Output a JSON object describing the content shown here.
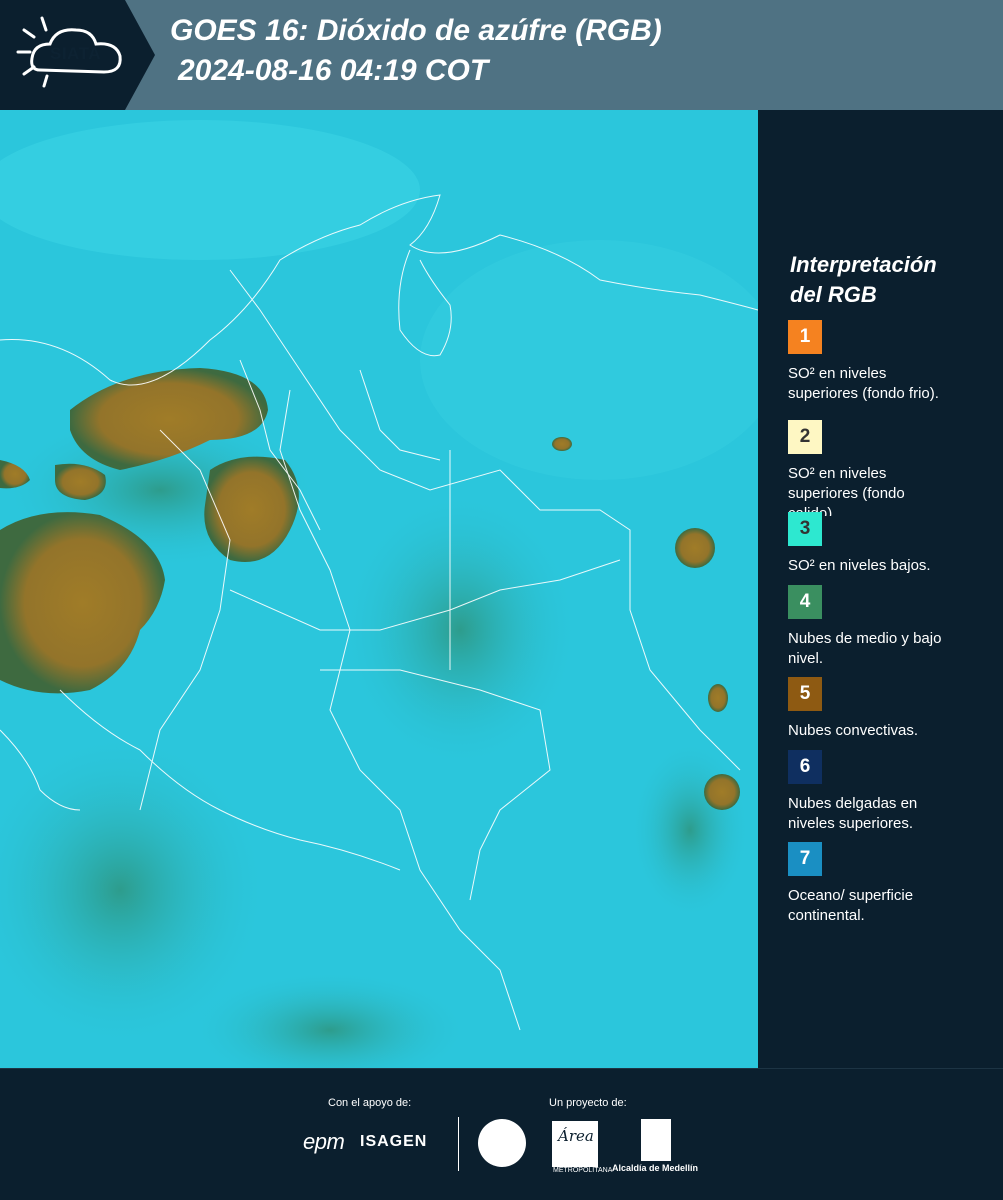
{
  "header": {
    "logo_text": "SIATA",
    "title_line1": "GOES 16: Dióxido de azúfre (RGB)",
    "title_line2": "2024-08-16 04:19 COT",
    "background_color": "#4f7283"
  },
  "legend": {
    "title_line1": "Interpretación",
    "title_line2": "del RGB",
    "items": [
      {
        "number": "1",
        "line1": "SO² en niveles",
        "line2": "superiores (fondo frio).",
        "color": "#f58220",
        "text_color": "#ffffff"
      },
      {
        "number": "2",
        "line1": "SO² en niveles",
        "line2": "superiores (fondo",
        "line3": "calido).",
        "color": "#fef7c3",
        "text_color": "#333333"
      },
      {
        "number": "3",
        "line1": "SO² en niveles bajos.",
        "color": "#2de8d0",
        "text_color": "#333333"
      },
      {
        "number": "4",
        "line1": "Nubes de medio y bajo",
        "line2": "nivel.",
        "color": "#3a8f60",
        "text_color": "#ffffff"
      },
      {
        "number": "5",
        "line1": "Nubes convectivas.",
        "color": "#8e5a12",
        "text_color": "#ffffff"
      },
      {
        "number": "6",
        "line1": "Nubes delgadas en",
        "line2": "niveles superiores.",
        "color": "#0f2f60",
        "text_color": "#ffffff"
      },
      {
        "number": "7",
        "line1": "Oceano/ superficie",
        "line2": "continental.",
        "color": "#1a8fc3",
        "text_color": "#ffffff"
      }
    ]
  },
  "footer": {
    "support_label": "Con el apoyo de:",
    "project_label": "Un proyecto de:",
    "epm": "epm",
    "isagen": "ISAGEN",
    "area_word": "Área",
    "area_sub": "METROPOLITANA",
    "alcaldia": "Alcaldía de Medellín"
  },
  "map": {
    "background_color": "#2bc6dc",
    "convective_cloud_color": "#9a7a2a",
    "border_color": "#ffffff"
  }
}
